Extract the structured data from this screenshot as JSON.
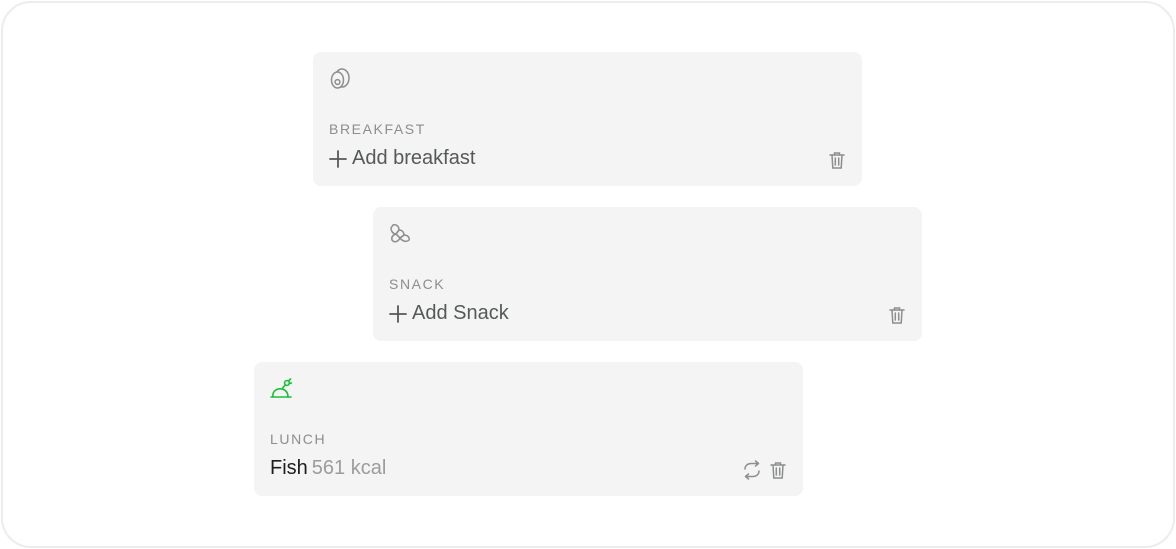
{
  "meals": [
    {
      "title": "BREAKFAST",
      "add_label": "Add breakfast",
      "icon": "egg-icon"
    },
    {
      "title": "SNACK",
      "add_label": "Add Snack",
      "icon": "croissant-icon"
    },
    {
      "title": "LUNCH",
      "food_name": "Fish",
      "kcal": "561 kcal",
      "icon": "chicken-icon",
      "icon_color": "#1dbf3a"
    }
  ],
  "colors": {
    "card_bg": "#f3f4f3",
    "accent_green": "#1dbf3a",
    "muted_icon": "#8c8f8e"
  }
}
